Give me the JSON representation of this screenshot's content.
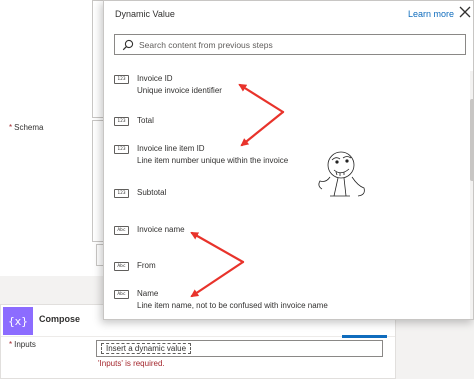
{
  "schema": {
    "required_mark": "*",
    "label": "Schema"
  },
  "compose": {
    "icon_text": "{x}",
    "title": "Compose",
    "inputs_required_mark": "*",
    "inputs_label": "Inputs",
    "inputs_placeholder": "Insert a dynamic value",
    "inputs_error": "'Inputs' is required.",
    "accent_color": "#8c6cff"
  },
  "flyout": {
    "title": "Dynamic Value",
    "learn_more": "Learn more",
    "close_icon": "close-icon",
    "search_icon": "search-icon",
    "search_placeholder": "Search content from previous steps",
    "items": [
      {
        "type": "123",
        "name": "Invoice ID",
        "description": "Unique invoice identifier"
      },
      {
        "type": "123",
        "name": "Total",
        "description": ""
      },
      {
        "type": "123",
        "name": "Invoice line item ID",
        "description": "Line item number unique within the invoice"
      },
      {
        "type": "123",
        "name": "Subtotal",
        "description": ""
      },
      {
        "type": "Abc",
        "name": "Invoice name",
        "description": ""
      },
      {
        "type": "Abc",
        "name": "From",
        "description": ""
      },
      {
        "type": "Abc",
        "name": "Name",
        "description": "Line item name, not to be confused with invoice name"
      }
    ]
  },
  "annotations": {
    "arrow_color": "#e8332b"
  }
}
